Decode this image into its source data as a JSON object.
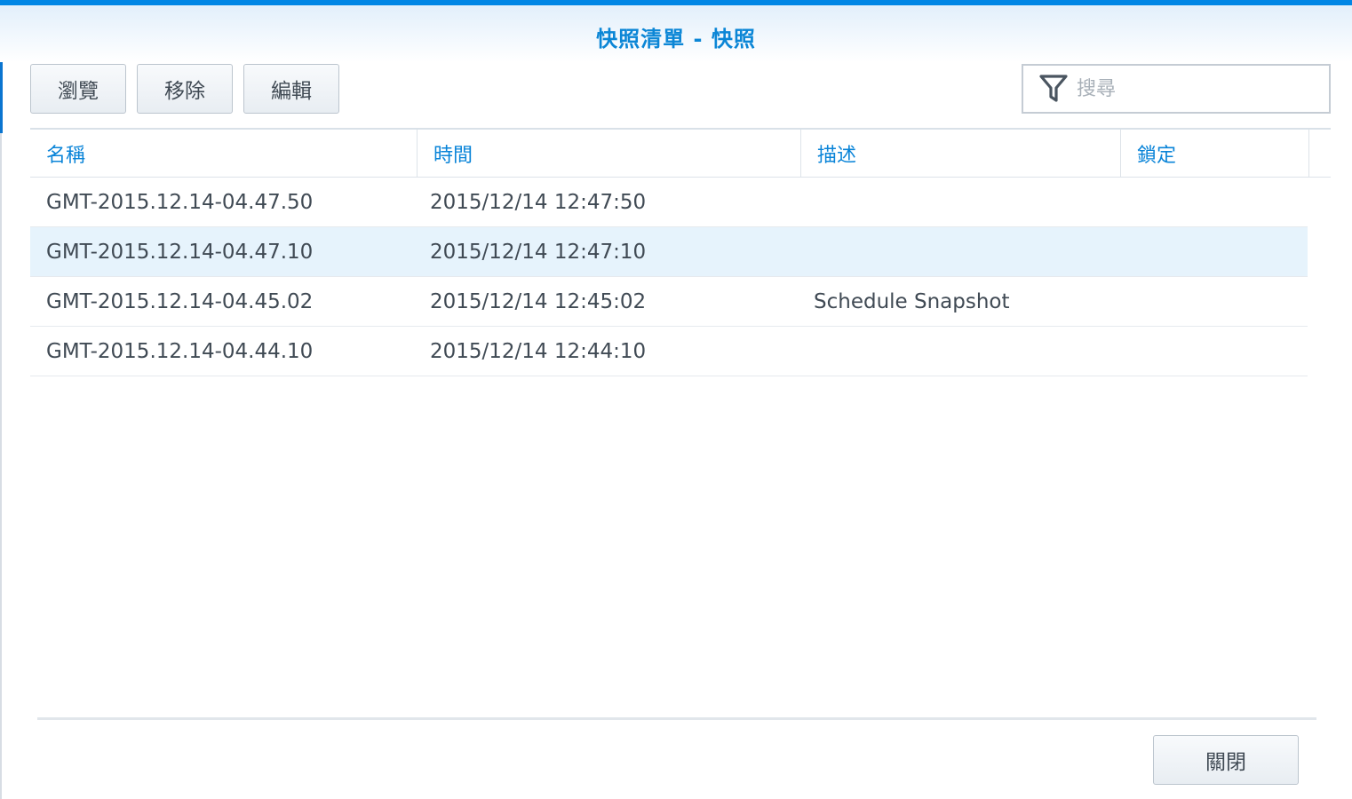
{
  "window": {
    "title": "快照清單 - 快照"
  },
  "toolbar": {
    "browse_label": "瀏覽",
    "remove_label": "移除",
    "edit_label": "編輯",
    "search_placeholder": "搜尋"
  },
  "table": {
    "columns": [
      "名稱",
      "時間",
      "描述",
      "鎖定"
    ],
    "rows": [
      {
        "name": "GMT-2015.12.14-04.47.50",
        "time": "2015/12/14 12:47:50",
        "description": "",
        "locked": "",
        "selected": false
      },
      {
        "name": "GMT-2015.12.14-04.47.10",
        "time": "2015/12/14 12:47:10",
        "description": "",
        "locked": "",
        "selected": true
      },
      {
        "name": "GMT-2015.12.14-04.45.02",
        "time": "2015/12/14 12:45:02",
        "description": "Schedule Snapshot",
        "locked": "",
        "selected": false
      },
      {
        "name": "GMT-2015.12.14-04.44.10",
        "time": "2015/12/14 12:44:10",
        "description": "",
        "locked": "",
        "selected": false
      }
    ]
  },
  "footer": {
    "close_label": "關閉"
  },
  "colors": {
    "accent": "#0b86d6",
    "selected_row": "#e6f3fc",
    "top_bar": "#0086e5"
  },
  "icons": {
    "search": "filter-icon"
  }
}
